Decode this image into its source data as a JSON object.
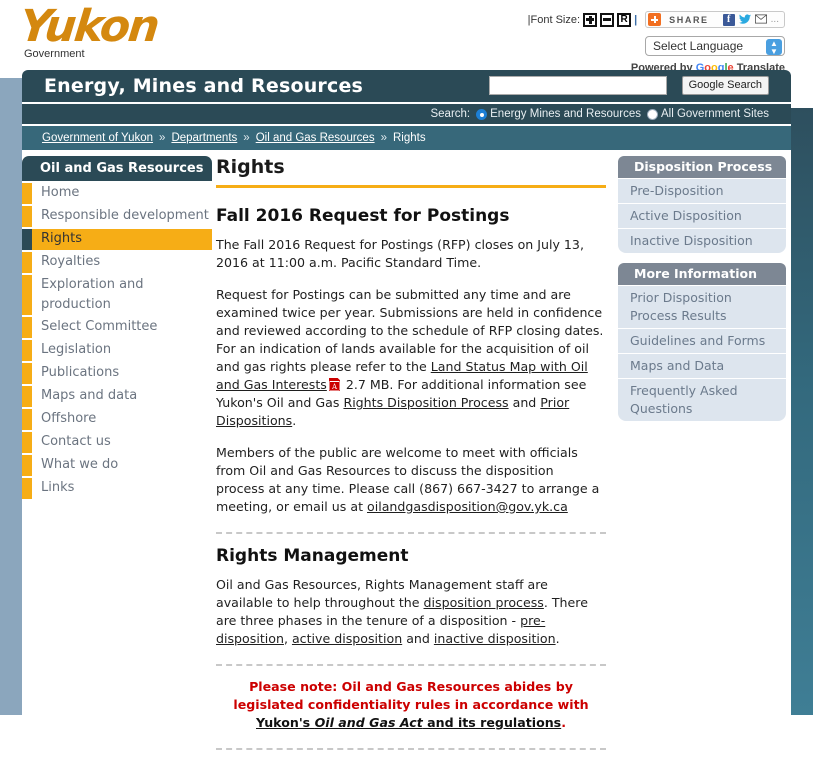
{
  "header": {
    "logo_text": "Yukon",
    "logo_sub": "Government",
    "font_size_label": "|Font Size:",
    "font_btn_increase": "+",
    "font_btn_decrease": "-",
    "font_btn_reset": "R",
    "share_label": "SHARE",
    "fb_label": "f",
    "tw_label": "ᵛ",
    "mail_label": "✉",
    "more_label": "...",
    "language_value": "Select Language",
    "translate_credit_prefix": "Powered by ",
    "translate_credit_google": "Google",
    "translate_credit_suffix": " Translate"
  },
  "titlebar": {
    "department": "Energy, Mines and Resources",
    "search_value": "",
    "search_placeholder": "",
    "search_button": "Google Search",
    "search_scope_label": "Search:",
    "scope_option_1": "Energy Mines and Resources",
    "scope_option_2": "All Government Sites",
    "selected_scope": "Energy Mines and Resources"
  },
  "breadcrumb": {
    "items": [
      {
        "label": "Government of Yukon",
        "link": true
      },
      {
        "label": "Departments",
        "link": true
      },
      {
        "label": "Oil and Gas Resources",
        "link": true
      },
      {
        "label": "Rights",
        "link": false
      }
    ],
    "separator": "»"
  },
  "left_nav": {
    "header": "Oil and Gas Resources",
    "items": [
      {
        "label": "Home",
        "active": false
      },
      {
        "label": "Responsible development",
        "active": false
      },
      {
        "label": "Rights",
        "active": true
      },
      {
        "label": "Royalties",
        "active": false
      },
      {
        "label": "Exploration and production",
        "active": false
      },
      {
        "label": "Select Committee",
        "active": false
      },
      {
        "label": "Legislation",
        "active": false
      },
      {
        "label": "Publications",
        "active": false
      },
      {
        "label": "Maps and data",
        "active": false
      },
      {
        "label": "Offshore",
        "active": false
      },
      {
        "label": "Contact us",
        "active": false
      },
      {
        "label": "What we do",
        "active": false
      },
      {
        "label": "Links",
        "active": false
      }
    ]
  },
  "main": {
    "page_title": "Rights",
    "section1_heading": "Fall 2016 Request for Postings",
    "p1": "The Fall 2016 Request for Postings (RFP) closes on July 13, 2016 at 11:00 a.m. Pacific Standard Time.",
    "p2_part1": "Request for Postings can be submitted any time and are examined twice per year. Submissions are held in confidence and reviewed according to the schedule of RFP closing dates. For an indication of lands available for the acquisition of oil and gas rights please refer to the ",
    "p2_link1": "Land Status Map with Oil and Gas Interests",
    "p2_filesize": " 2.7 MB. For additional information see Yukon's Oil and Gas ",
    "p2_link2": "Rights Disposition Process",
    "p2_and": " and ",
    "p2_link3": "Prior Dispositions",
    "p2_end": ".",
    "p3_part1": "Members of the public are welcome to meet with officials from Oil and Gas Resources to discuss the disposition process at any time.  Please call (867) 667-3427 to arrange a meeting, or email us at ",
    "p3_email": "oilandgasdisposition@gov.yk.ca",
    "section2_heading": "Rights Management",
    "p4_part1": "Oil and Gas Resources, Rights Management staff are available to help throughout the ",
    "p4_link1": "disposition process",
    "p4_part2": ". There are three phases in the tenure of a disposition - ",
    "p4_link2": "pre-disposition",
    "p4_comma": ", ",
    "p4_link3": "active disposition",
    "p4_and": " and ",
    "p4_link4": "inactive disposition",
    "p4_end": ".",
    "note_part1": "Please note: Oil and Gas Resources abides by legislated confidentiality rules in accordance with ",
    "note_link_pre": "Yukon's ",
    "note_link_ital": "Oil and Gas Act",
    "note_link_post": " and its regulations",
    "note_end": "."
  },
  "right_nav": {
    "blocks": [
      {
        "header": "Disposition Process",
        "items": [
          "Pre-Disposition",
          "Active Disposition",
          "Inactive Disposition"
        ]
      },
      {
        "header": "More Information",
        "items": [
          "Prior Disposition Process Results",
          "Guidelines and Forms",
          "Maps and Data",
          "Frequently Asked Questions"
        ]
      }
    ]
  },
  "colors": {
    "brand_orange": "#f6ad16",
    "logo_orange": "#d4880f",
    "dark_header": "#2b4a56",
    "breadcrumb_teal": "#37687a",
    "right_nav_header": "#7d8794",
    "right_nav_item": "#dde5ee",
    "note_red": "#cc0000",
    "page_edge": "#8ba6bd"
  }
}
